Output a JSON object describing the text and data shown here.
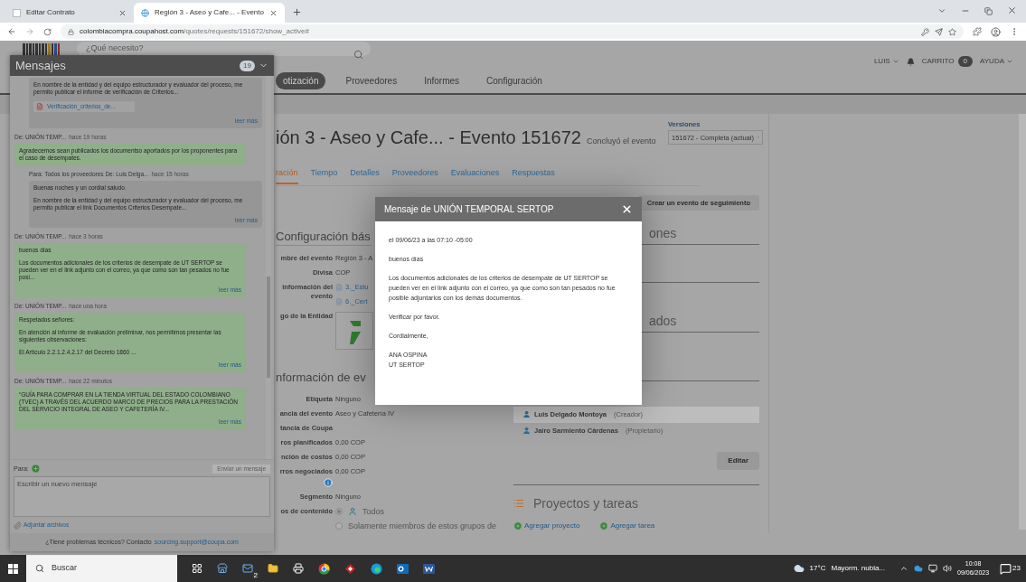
{
  "browser": {
    "tabs": [
      {
        "title": "Editar Contrato",
        "selected": false
      },
      {
        "title": "Región 3 - Aseo y Cafe... - Evento",
        "selected": true
      }
    ],
    "url_host": "colombiacompra.coupahost.com",
    "url_path": "/quotes/requests/151672/show_active#"
  },
  "header": {
    "search_placeholder": "¿Qué necesito?",
    "user": "LUIS",
    "cart_label": "CARRITO",
    "cart_count": "0",
    "help": "AYUDA",
    "nav": [
      {
        "label": "otización",
        "selected": true
      },
      {
        "label": "Proveedores",
        "selected": false
      },
      {
        "label": "Informes",
        "selected": false
      },
      {
        "label": "Configuración",
        "selected": false
      }
    ]
  },
  "event": {
    "title": "ión 3 - Aseo y Cafe... - Evento 151672",
    "status": "Concluyó el evento",
    "versions_label": "Versiones",
    "version": "151672 - Completa (actual)",
    "tabs": [
      {
        "label": "ración",
        "selected": true
      },
      {
        "label": "Tiempo",
        "selected": false
      },
      {
        "label": "Detalles",
        "selected": false
      },
      {
        "label": "Proveedores",
        "selected": false
      },
      {
        "label": "Evaluaciones",
        "selected": false
      },
      {
        "label": "Respuestas",
        "selected": false
      }
    ],
    "follow_up_button": "Crear un evento de seguimiento"
  },
  "config": {
    "heading": "Configuración bás",
    "fields": [
      {
        "kind": "text",
        "label": "mbre del evento",
        "value": "Región 3 - A"
      },
      {
        "kind": "text",
        "label": "Divisa",
        "value": "COP"
      },
      {
        "kind": "files",
        "label": "información del evento",
        "files": [
          "3._Estu",
          "6._Cert"
        ]
      },
      {
        "kind": "logo",
        "label": "go de la Entidad"
      }
    ]
  },
  "info": {
    "heading": "nformación de ev",
    "fields": [
      {
        "kind": "text",
        "label": "Etiqueta",
        "value": "Ninguno"
      },
      {
        "kind": "text",
        "label": "ancia del evento",
        "value": "Aseo y Cafetería IV"
      },
      {
        "kind": "text",
        "label": "tancia de Coupa"
      },
      {
        "kind": "text",
        "label": "ros planificados",
        "value": "0,00 COP"
      },
      {
        "kind": "text",
        "label": "nción de costos",
        "value": "0,00 COP"
      },
      {
        "kind": "info",
        "label": "rros negociados",
        "value": "0,00 COP"
      },
      {
        "kind": "text",
        "label": "Segmento",
        "value": "Ninguno"
      },
      {
        "kind": "radio",
        "label": "os de contenido",
        "options": [
          {
            "label": "Todos",
            "selected": true
          },
          {
            "label": "Solamente miembros de estos grupos de",
            "selected": false
          }
        ]
      }
    ]
  },
  "right": {
    "section_1_heading": "ones",
    "section_2_heading": "ados",
    "people": [
      {
        "name": "Luis Delgado Montoya",
        "role": "(Creador)",
        "highlighted": true
      },
      {
        "name": "Jairo Sarmiento Cárdenas",
        "role": "(Propietario)",
        "highlighted": false
      }
    ],
    "edit_button": "Editar",
    "projects_heading": "Proyectos y tareas",
    "add_project": "Agregar proyecto",
    "add_task": "Agregar tarea"
  },
  "messages": {
    "title": "Mensajes",
    "count": "19",
    "items": [
      {
        "kind": "sent",
        "paragraphs": [
          "En nombre de la entidad y del equipo estructurador y evaluador del proceso, me permito publicar el informe de verificación de Criterios..."
        ],
        "attachment": "Verificación_criterios_de...",
        "more": "leer más"
      },
      {
        "kind": "received",
        "from": "De: UNIÓN TEMP...",
        "time": "hace 19 horas",
        "paragraphs": [
          "Agradecemos sean publicados los documentso aportados por los proponentes para el caso de desempates."
        ]
      },
      {
        "kind": "sent",
        "from": "Para: Todos los proveedores De: Luis Delga...",
        "time": "hace 15 horas",
        "paragraphs": [
          "Buenas noches y un cordial saludo.",
          "En nombre de la entidad y del equipo estructurador y evaluador del proceso, me permito publicar el link Documentos Criterios Desempate..."
        ],
        "more": "leer más"
      },
      {
        "kind": "received",
        "from": "De: UNIÓN TEMP...",
        "time": "hace 3 horas",
        "paragraphs": [
          "buenos días",
          "Los documentos adicionales de los criterios de desempate de UT SERTOP se pueden ver en el link adjunto con el correo, ya que como son tan pesados no fue posi..."
        ],
        "more": "leer más"
      },
      {
        "kind": "received",
        "from": "De: UNIÓN TEMP...",
        "time": "hace una hora",
        "paragraphs": [
          "Respetados señores:",
          "En atención al informe de evaluación preliminar, nos permitimos presentar las siguientes observaciones:",
          "El Artículo 2.2.1.2.4.2.17 del Decreto 1860 ..."
        ],
        "more": "leer más"
      },
      {
        "kind": "received",
        "from": "De: UNIÓN TEMP...",
        "time": "hace 22 minutos",
        "paragraphs": [
          "“GUÍA PARA COMPRAR EN LA TIENDA VIRTUAL DEL ESTADO COLOMBIANO (TVEC) A TRAVÉS DEL ACUERDO MARCO DE PRECIOS PARA LA PRESTACIÓN DEL SERVICIO INTEGRAL DE ASEO Y CAFETERÍA IV..."
        ],
        "more": "leer más"
      }
    ],
    "to_label": "Para:",
    "send_button": "Enviar un mensaje",
    "compose_placeholder": "Escribir un nuevo mensaje",
    "attach": "Adjuntar archivos",
    "support_text": "¿Tiene problemas técnicos? Contacto",
    "support_email": "sourcing.support@coupa.com"
  },
  "modal": {
    "title": "Mensaje de UNIÓN TEMPORAL SERTOP",
    "paragraphs": [
      "el 09/06/23 a las 07:10 -05:00",
      "buenos días",
      "Los documentos adicionales de los criterios de desempate de UT SERTOP se pueden ver en el link adjunto con el correo, ya que como son tan pesados no fue posible adjuntarlos con los demás documentos.",
      "Verificar por favor.",
      "Cordialmente,",
      "ANA OSPINA\nUT SERTOP"
    ]
  },
  "taskbar": {
    "search_placeholder": "Buscar",
    "mail_badge": "2",
    "weather_temp": "17°C",
    "weather_text": "Mayorm. nubla...",
    "time": "10:08",
    "date": "09/06/2023",
    "notifications": "23"
  }
}
